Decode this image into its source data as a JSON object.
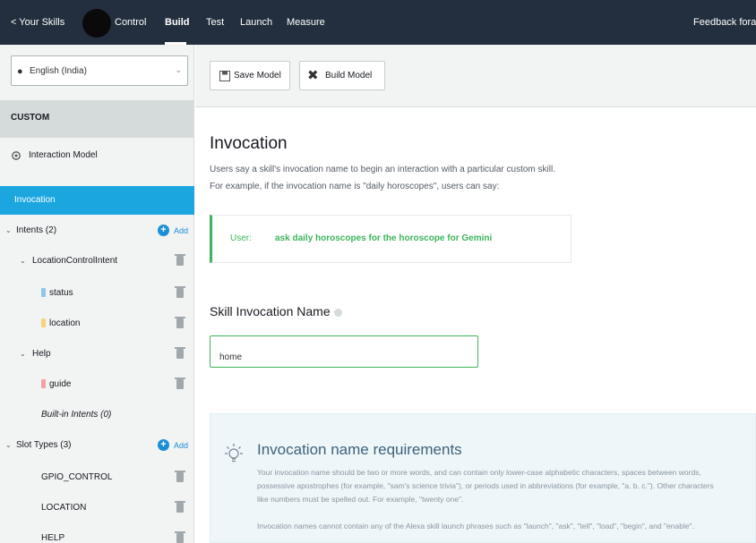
{
  "topnav": {
    "back_label": "< Your Skills",
    "tabs": [
      "Control",
      "Build",
      "Test",
      "Launch",
      "Measure"
    ],
    "active_tab": "Build",
    "feedback_label": "Feedback fora"
  },
  "sidebar": {
    "language": "English (India)",
    "section_label": "CUSTOM",
    "interaction_model": "Interaction Model",
    "invocation": "Invocation",
    "intents_label": "Intents (2)",
    "add_label": "Add",
    "intents": [
      {
        "name": "LocationControlIntent",
        "slots": [
          "status",
          "location"
        ]
      },
      {
        "name": "Help",
        "slots": [
          "guide"
        ]
      }
    ],
    "builtin_intents": "Built-in Intents (0)",
    "slot_types_label": "Slot Types (3)",
    "slot_types": [
      "GPIO_CONTROL",
      "LOCATION",
      "HELP"
    ],
    "colors": {
      "selected": "#1ba6e0",
      "status_slot": "#8fc7ea",
      "location_slot": "#f5d47a",
      "guide_slot": "#f2a2a2"
    }
  },
  "toolbar": {
    "save_label": "Save Model",
    "build_label": "Build Model"
  },
  "main": {
    "title": "Invocation",
    "desc_1": "Users say a skill's invocation name to begin an interaction with a particular custom skill.",
    "desc_2": "For example, if the invocation name is \"daily horoscopes\", users can say:",
    "example_speaker": "User:",
    "example_utterance": "ask daily horoscopes for the horoscope for Gemini",
    "invocation_name_label": "Skill Invocation Name",
    "invocation_name_value": "home",
    "requirements": {
      "title": "Invocation name requirements",
      "line_1": "Your invocation name should be two or more words, and can contain only lower-case alphabetic characters, spaces between words,",
      "line_2": "possessive apostrophes (for example, \"sam's science trivia\"), or periods used in abbreviations (for example, \"a. b. c.\"). Other characters",
      "line_3": "like numbers must be spelled out. For example, \"twenty one\".",
      "line_4": "Invocation names cannot contain any of the Alexa skill launch phrases such as \"launch\", \"ask\", \"tell\", \"load\", \"begin\", and \"enable\"."
    }
  }
}
